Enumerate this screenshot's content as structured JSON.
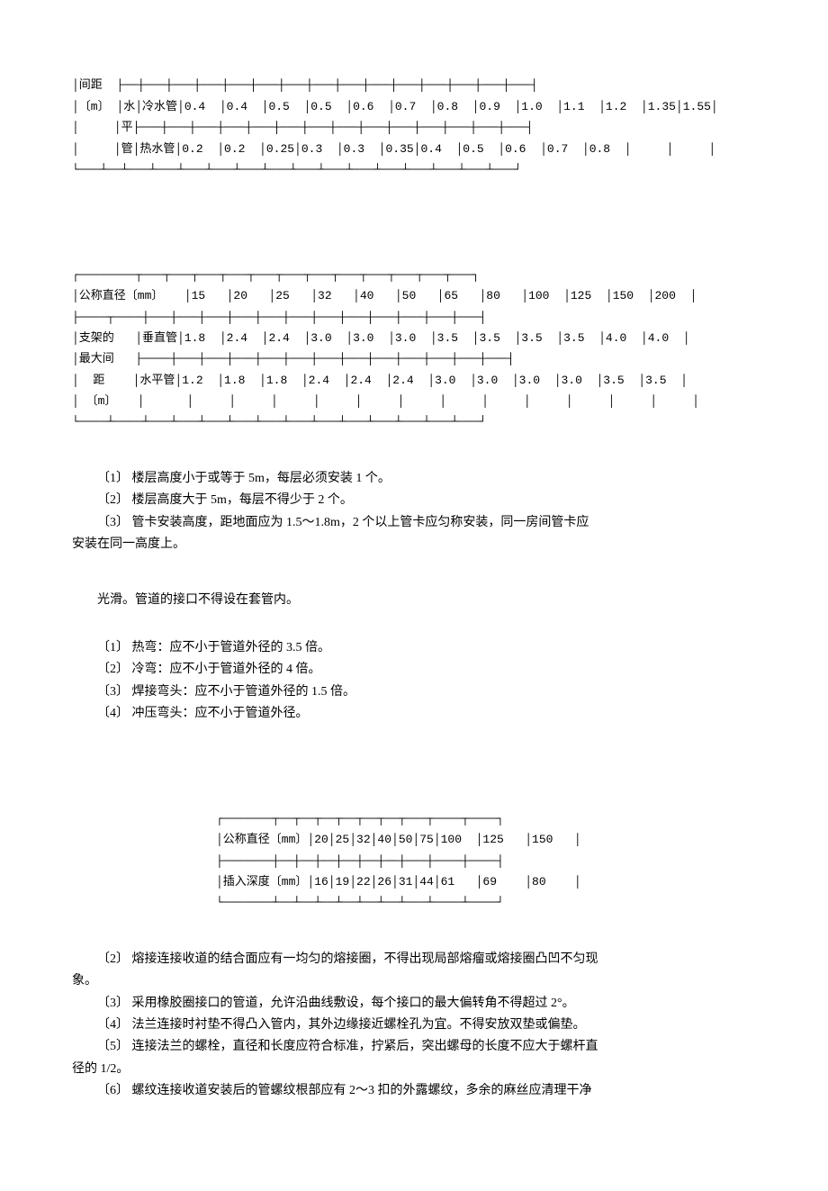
{
  "table1": {
    "row1_label_part1": "│间距",
    "row2_label_part1": "│〔m〕",
    "row2_sublabel1": "│水│冷水管",
    "row2_values": "│0.4  │0.4  │0.5  │0.5  │0.6  │0.7  │0.8  │0.9  │1.0  │1.1  │1.2  │1.35│1.55│",
    "row3_label": "│     │平",
    "row4_label": "│     │管│热水管",
    "row4_values": "│0.2  │0.2  │0.25│0.3  │0.3  │0.35│0.4  │0.5  │0.6  │0.7  │0.8  │     │     │"
  },
  "table2": {
    "header_label": "│公称直径〔mm〕",
    "header_values": "   │15   │20   │25   │32   │40   │50   │65   │80   │100  │125  │150  │200  │",
    "row1_label1": "│支架的",
    "row1_label2": "   │垂直管",
    "row1_values": "│1.8  │2.4  │2.4  │3.0  │3.0  │3.0  │3.5  │3.5  │3.5  │3.5  │4.0  │4.0  │",
    "row2_label1": "│最大间",
    "row3_label1": "│  距",
    "row3_label2": "    │水平管",
    "row3_values": "│1.2  │1.8  │1.8  │2.4  │2.4  │2.4  │3.0  │3.0  │3.0  │3.0  │3.5  │3.5  │",
    "row4_label": "│ 〔m〕",
    "row4_blanks": "   │      │     │     │     │     │     │     │     │     │     │     │     │     │"
  },
  "notes1": {
    "n1": "〔1〕 楼层高度小于或等于 5m，每层必须安装 1 个。",
    "n2": "〔2〕 楼层高度大于 5m，每层不得少于 2 个。",
    "n3": "〔3〕 管卡安装高度，距地面应为 1.5～1.8m，2 个以上管卡应匀称安装，同一房间管卡应",
    "n3b": "安装在同一高度上。"
  },
  "section2": {
    "p1": "光滑。管道的接口不得设在套管内。",
    "b1": "〔1〕 热弯：应不小于管道外径的 3.5 倍。",
    "b2": "〔2〕 冷弯：应不小于管道外径的 4 倍。",
    "b3": "〔3〕 焊接弯头：应不小于管道外径的 1.5 倍。",
    "b4": "〔4〕 冲压弯头：应不小于管道外径。"
  },
  "table3": {
    "header": "│公称直径〔mm〕│20│25│32│40│50│75│100  │125   │150   │",
    "row1": "│插入深度〔mm〕│16│19│22│26│31│44│61   │69    │80    │"
  },
  "notes2": {
    "n2": "〔2〕 熔接连接收道的结合面应有一均匀的熔接圈，不得出现局部熔瘤或熔接圈凸凹不匀现",
    "n2b": "象。",
    "n3": "〔3〕 采用橡胶圈接口的管道，允许沿曲线敷设，每个接口的最大偏转角不得超过 2°。",
    "n4": "〔4〕 法兰连接时衬垫不得凸入管内，其外边缘接近螺栓孔为宜。不得安放双垫或偏垫。",
    "n5": "〔5〕 连接法兰的螺栓，直径和长度应符合标准，拧紧后，突出螺母的长度不应大于螺杆直",
    "n5b": "径的 1/2。",
    "n6": "〔6〕 螺纹连接收道安装后的管螺纹根部应有 2～3 扣的外露螺纹，多余的麻丝应清理干净"
  }
}
